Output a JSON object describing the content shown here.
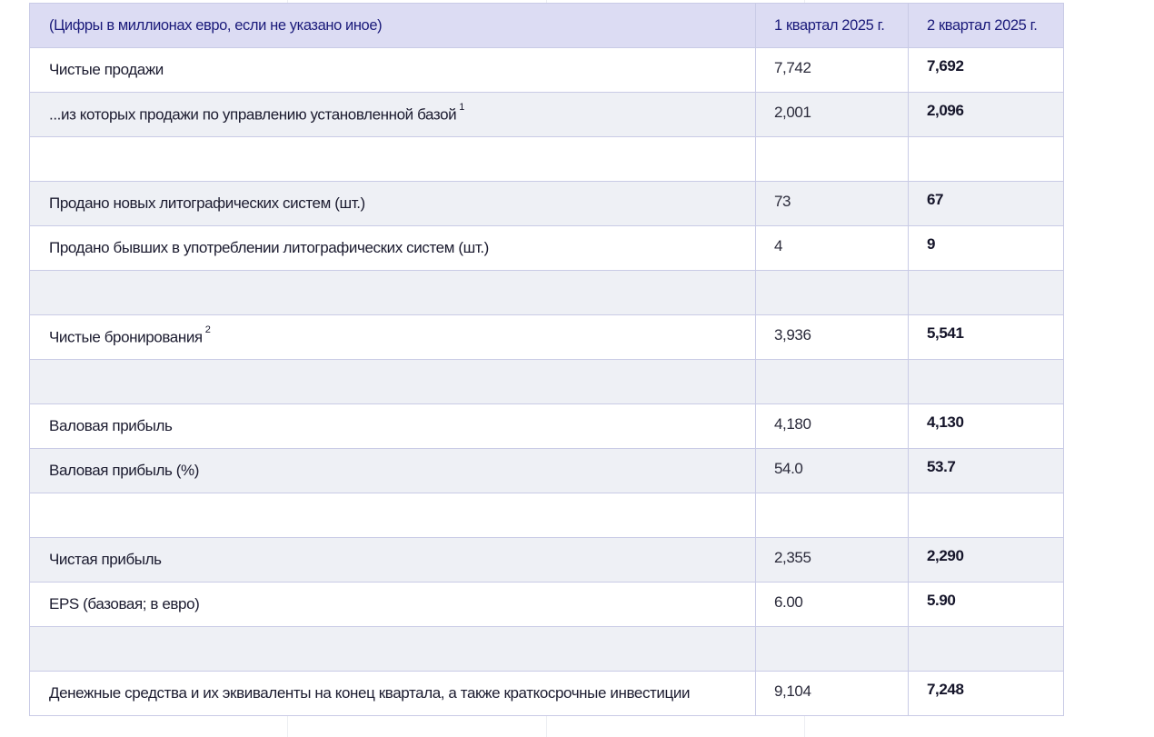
{
  "table": {
    "header": {
      "label": "(Цифры в миллионах евро, если не указано иное)",
      "q1": "1 квартал 2025 г.",
      "q2": "2 квартал 2025 г."
    },
    "rows": [
      {
        "label": "Чистые продажи",
        "footnote": "",
        "q1": "7,742",
        "q2": "7,692"
      },
      {
        "label": "...из которых продажи по управлению установленной базой",
        "footnote": "1",
        "q1": "2,001",
        "q2": "2,096"
      },
      {
        "label": "",
        "footnote": "",
        "q1": "",
        "q2": ""
      },
      {
        "label": "Продано новых литографических систем (шт.)",
        "footnote": "",
        "q1": "73",
        "q2": "67"
      },
      {
        "label": "Продано бывших в употреблении литографических систем (шт.)",
        "footnote": "",
        "q1": "4",
        "q2": "9"
      },
      {
        "label": "",
        "footnote": "",
        "q1": "",
        "q2": ""
      },
      {
        "label": "Чистые бронирования",
        "footnote": "2",
        "q1": "3,936",
        "q2": "5,541"
      },
      {
        "label": "",
        "footnote": "",
        "q1": "",
        "q2": ""
      },
      {
        "label": "Валовая прибыль",
        "footnote": "",
        "q1": "4,180",
        "q2": "4,130"
      },
      {
        "label": "Валовая прибыль (%)",
        "footnote": "",
        "q1": "54.0",
        "q2": "53.7"
      },
      {
        "label": "",
        "footnote": "",
        "q1": "",
        "q2": ""
      },
      {
        "label": "Чистая прибыль",
        "footnote": "",
        "q1": "2,355",
        "q2": "2,290"
      },
      {
        "label": "EPS (базовая; в евро)",
        "footnote": "",
        "q1": "6.00",
        "q2": "5.90"
      },
      {
        "label": "",
        "footnote": "",
        "q1": "",
        "q2": ""
      },
      {
        "label": "Денежные средства и их эквиваленты на конец квартала, а также краткосрочные инвестиции",
        "footnote": "",
        "q1": "9,104",
        "q2": "7,248"
      }
    ]
  }
}
